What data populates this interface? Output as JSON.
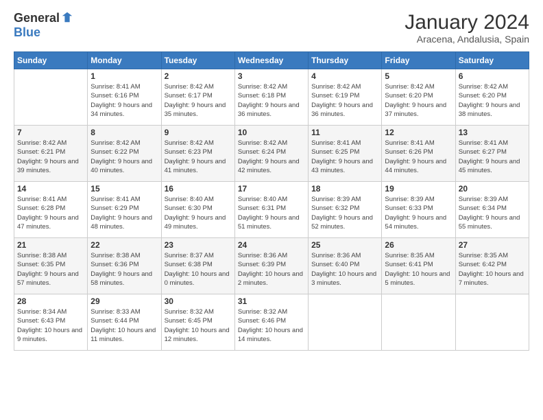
{
  "header": {
    "logo_general": "General",
    "logo_blue": "Blue",
    "month": "January 2024",
    "location": "Aracena, Andalusia, Spain"
  },
  "days_of_week": [
    "Sunday",
    "Monday",
    "Tuesday",
    "Wednesday",
    "Thursday",
    "Friday",
    "Saturday"
  ],
  "weeks": [
    [
      null,
      {
        "day": "1",
        "sunrise": "Sunrise: 8:41 AM",
        "sunset": "Sunset: 6:16 PM",
        "daylight": "Daylight: 9 hours and 34 minutes."
      },
      {
        "day": "2",
        "sunrise": "Sunrise: 8:42 AM",
        "sunset": "Sunset: 6:17 PM",
        "daylight": "Daylight: 9 hours and 35 minutes."
      },
      {
        "day": "3",
        "sunrise": "Sunrise: 8:42 AM",
        "sunset": "Sunset: 6:18 PM",
        "daylight": "Daylight: 9 hours and 36 minutes."
      },
      {
        "day": "4",
        "sunrise": "Sunrise: 8:42 AM",
        "sunset": "Sunset: 6:19 PM",
        "daylight": "Daylight: 9 hours and 36 minutes."
      },
      {
        "day": "5",
        "sunrise": "Sunrise: 8:42 AM",
        "sunset": "Sunset: 6:20 PM",
        "daylight": "Daylight: 9 hours and 37 minutes."
      },
      {
        "day": "6",
        "sunrise": "Sunrise: 8:42 AM",
        "sunset": "Sunset: 6:20 PM",
        "daylight": "Daylight: 9 hours and 38 minutes."
      }
    ],
    [
      {
        "day": "7",
        "sunrise": "Sunrise: 8:42 AM",
        "sunset": "Sunset: 6:21 PM",
        "daylight": "Daylight: 9 hours and 39 minutes."
      },
      {
        "day": "8",
        "sunrise": "Sunrise: 8:42 AM",
        "sunset": "Sunset: 6:22 PM",
        "daylight": "Daylight: 9 hours and 40 minutes."
      },
      {
        "day": "9",
        "sunrise": "Sunrise: 8:42 AM",
        "sunset": "Sunset: 6:23 PM",
        "daylight": "Daylight: 9 hours and 41 minutes."
      },
      {
        "day": "10",
        "sunrise": "Sunrise: 8:42 AM",
        "sunset": "Sunset: 6:24 PM",
        "daylight": "Daylight: 9 hours and 42 minutes."
      },
      {
        "day": "11",
        "sunrise": "Sunrise: 8:41 AM",
        "sunset": "Sunset: 6:25 PM",
        "daylight": "Daylight: 9 hours and 43 minutes."
      },
      {
        "day": "12",
        "sunrise": "Sunrise: 8:41 AM",
        "sunset": "Sunset: 6:26 PM",
        "daylight": "Daylight: 9 hours and 44 minutes."
      },
      {
        "day": "13",
        "sunrise": "Sunrise: 8:41 AM",
        "sunset": "Sunset: 6:27 PM",
        "daylight": "Daylight: 9 hours and 45 minutes."
      }
    ],
    [
      {
        "day": "14",
        "sunrise": "Sunrise: 8:41 AM",
        "sunset": "Sunset: 6:28 PM",
        "daylight": "Daylight: 9 hours and 47 minutes."
      },
      {
        "day": "15",
        "sunrise": "Sunrise: 8:41 AM",
        "sunset": "Sunset: 6:29 PM",
        "daylight": "Daylight: 9 hours and 48 minutes."
      },
      {
        "day": "16",
        "sunrise": "Sunrise: 8:40 AM",
        "sunset": "Sunset: 6:30 PM",
        "daylight": "Daylight: 9 hours and 49 minutes."
      },
      {
        "day": "17",
        "sunrise": "Sunrise: 8:40 AM",
        "sunset": "Sunset: 6:31 PM",
        "daylight": "Daylight: 9 hours and 51 minutes."
      },
      {
        "day": "18",
        "sunrise": "Sunrise: 8:39 AM",
        "sunset": "Sunset: 6:32 PM",
        "daylight": "Daylight: 9 hours and 52 minutes."
      },
      {
        "day": "19",
        "sunrise": "Sunrise: 8:39 AM",
        "sunset": "Sunset: 6:33 PM",
        "daylight": "Daylight: 9 hours and 54 minutes."
      },
      {
        "day": "20",
        "sunrise": "Sunrise: 8:39 AM",
        "sunset": "Sunset: 6:34 PM",
        "daylight": "Daylight: 9 hours and 55 minutes."
      }
    ],
    [
      {
        "day": "21",
        "sunrise": "Sunrise: 8:38 AM",
        "sunset": "Sunset: 6:35 PM",
        "daylight": "Daylight: 9 hours and 57 minutes."
      },
      {
        "day": "22",
        "sunrise": "Sunrise: 8:38 AM",
        "sunset": "Sunset: 6:36 PM",
        "daylight": "Daylight: 9 hours and 58 minutes."
      },
      {
        "day": "23",
        "sunrise": "Sunrise: 8:37 AM",
        "sunset": "Sunset: 6:38 PM",
        "daylight": "Daylight: 10 hours and 0 minutes."
      },
      {
        "day": "24",
        "sunrise": "Sunrise: 8:36 AM",
        "sunset": "Sunset: 6:39 PM",
        "daylight": "Daylight: 10 hours and 2 minutes."
      },
      {
        "day": "25",
        "sunrise": "Sunrise: 8:36 AM",
        "sunset": "Sunset: 6:40 PM",
        "daylight": "Daylight: 10 hours and 3 minutes."
      },
      {
        "day": "26",
        "sunrise": "Sunrise: 8:35 AM",
        "sunset": "Sunset: 6:41 PM",
        "daylight": "Daylight: 10 hours and 5 minutes."
      },
      {
        "day": "27",
        "sunrise": "Sunrise: 8:35 AM",
        "sunset": "Sunset: 6:42 PM",
        "daylight": "Daylight: 10 hours and 7 minutes."
      }
    ],
    [
      {
        "day": "28",
        "sunrise": "Sunrise: 8:34 AM",
        "sunset": "Sunset: 6:43 PM",
        "daylight": "Daylight: 10 hours and 9 minutes."
      },
      {
        "day": "29",
        "sunrise": "Sunrise: 8:33 AM",
        "sunset": "Sunset: 6:44 PM",
        "daylight": "Daylight: 10 hours and 11 minutes."
      },
      {
        "day": "30",
        "sunrise": "Sunrise: 8:32 AM",
        "sunset": "Sunset: 6:45 PM",
        "daylight": "Daylight: 10 hours and 12 minutes."
      },
      {
        "day": "31",
        "sunrise": "Sunrise: 8:32 AM",
        "sunset": "Sunset: 6:46 PM",
        "daylight": "Daylight: 10 hours and 14 minutes."
      },
      null,
      null,
      null
    ]
  ]
}
